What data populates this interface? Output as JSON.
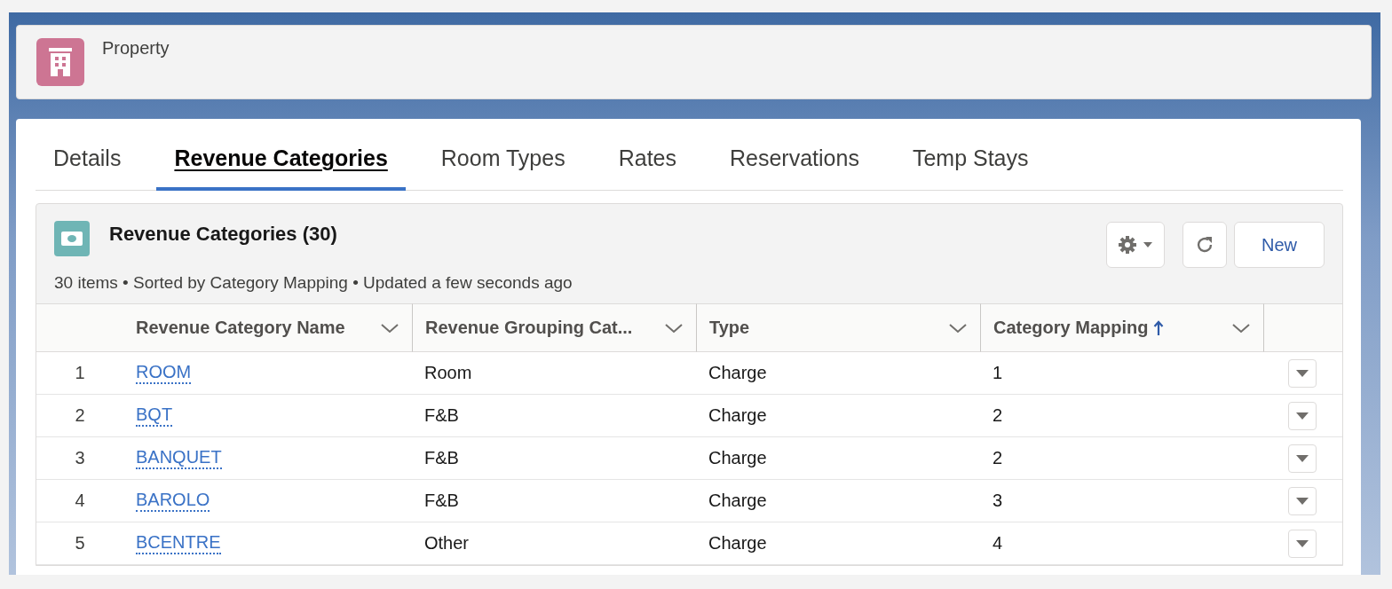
{
  "record_header": {
    "object_label": "Property"
  },
  "tabs": [
    {
      "label": "Details",
      "selected": false
    },
    {
      "label": "Revenue Categories",
      "selected": true
    },
    {
      "label": "Room Types",
      "selected": false
    },
    {
      "label": "Rates",
      "selected": false
    },
    {
      "label": "Reservations",
      "selected": false
    },
    {
      "label": "Temp Stays",
      "selected": false
    }
  ],
  "related_list": {
    "title": "Revenue Categories (30)",
    "summary": "30 items • Sorted by Category Mapping • Updated a few seconds ago",
    "new_button": "New",
    "columns": [
      {
        "label": "Revenue Category Name",
        "sorted": false
      },
      {
        "label": "Revenue Grouping Cat...",
        "sorted": false
      },
      {
        "label": "Type",
        "sorted": false
      },
      {
        "label": "Category Mapping",
        "sorted": true
      }
    ],
    "rows": [
      {
        "number": "1",
        "name": "ROOM",
        "grouping": "Room",
        "type": "Charge",
        "mapping": "1"
      },
      {
        "number": "2",
        "name": "BQT",
        "grouping": "F&B",
        "type": "Charge",
        "mapping": "2"
      },
      {
        "number": "3",
        "name": "BANQUET",
        "grouping": "F&B",
        "type": "Charge",
        "mapping": "2"
      },
      {
        "number": "4",
        "name": "BAROLO",
        "grouping": "F&B",
        "type": "Charge",
        "mapping": "3"
      },
      {
        "number": "5",
        "name": "BCENTRE",
        "grouping": "Other",
        "type": "Charge",
        "mapping": "4"
      }
    ]
  }
}
